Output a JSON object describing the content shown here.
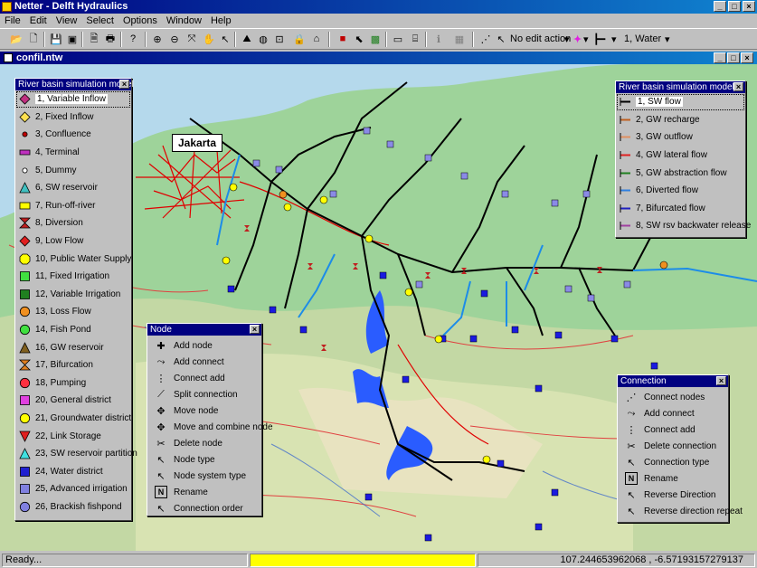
{
  "window": {
    "title": "Netter - Delft Hydraulics",
    "min": "_",
    "max": "□",
    "close": "×"
  },
  "menu": [
    "File",
    "Edit",
    "View",
    "Select",
    "Options",
    "Window",
    "Help"
  ],
  "toolbar": {
    "edit_action": "No edit action",
    "layer": "1, Water"
  },
  "document": {
    "title": "confil.ntw",
    "min": "_",
    "max": "□",
    "close": "×"
  },
  "map": {
    "city_label": "Jakarta"
  },
  "node_types_panel": {
    "title": "River basin simulation model",
    "close": "×",
    "items": [
      {
        "label": "1, Variable Inflow",
        "color": "#c03080",
        "shape": "diamond"
      },
      {
        "label": "2, Fixed Inflow",
        "color": "#ffe050",
        "shape": "diamond"
      },
      {
        "label": "3, Confluence",
        "color": "#c00000",
        "shape": "dot"
      },
      {
        "label": "4, Terminal",
        "color": "#c030c0",
        "shape": "bar"
      },
      {
        "label": "5, Dummy",
        "color": "#ffffff",
        "shape": "dot"
      },
      {
        "label": "6, SW reservoir",
        "color": "#40c0c0",
        "shape": "triangle"
      },
      {
        "label": "7, Run-off-river",
        "color": "#ffff00",
        "shape": "rect"
      },
      {
        "label": "8, Diversion",
        "color": "#c02020",
        "shape": "hourglass"
      },
      {
        "label": "9, Low Flow",
        "color": "#e02020",
        "shape": "diamond"
      },
      {
        "label": "10, Public Water Supply",
        "color": "#ffff00",
        "shape": "octagon"
      },
      {
        "label": "11, Fixed Irrigation",
        "color": "#40e040",
        "shape": "square"
      },
      {
        "label": "12, Variable Irrigation",
        "color": "#208020",
        "shape": "square"
      },
      {
        "label": "13, Loss Flow",
        "color": "#f09020",
        "shape": "circle"
      },
      {
        "label": "14, Fish Pond",
        "color": "#40e040",
        "shape": "circle"
      },
      {
        "label": "16, GW reservoir",
        "color": "#806020",
        "shape": "triangle"
      },
      {
        "label": "17, Bifurcation",
        "color": "#e08020",
        "shape": "hourglass"
      },
      {
        "label": "18, Pumping",
        "color": "#ff3040",
        "shape": "circle"
      },
      {
        "label": "20, General district",
        "color": "#e040e0",
        "shape": "square"
      },
      {
        "label": "21, Groundwater district",
        "color": "#ffff00",
        "shape": "circle"
      },
      {
        "label": "22, Link Storage",
        "color": "#e02020",
        "shape": "invtriangle"
      },
      {
        "label": "23, SW reservoir partition",
        "color": "#40e0e0",
        "shape": "triangle"
      },
      {
        "label": "24, Water district",
        "color": "#2020d0",
        "shape": "square"
      },
      {
        "label": "25, Advanced irrigation",
        "color": "#8080e0",
        "shape": "square"
      },
      {
        "label": "26, Brackish fishpond",
        "color": "#8080e0",
        "shape": "circle"
      }
    ]
  },
  "link_types_panel": {
    "title": "River basin simulation model",
    "close": "×",
    "items": [
      {
        "label": "1, SW flow",
        "color": "#000000"
      },
      {
        "label": "2, GW recharge",
        "color": "#c06020"
      },
      {
        "label": "3, GW outflow",
        "color": "#e09060"
      },
      {
        "label": "4, GW lateral flow",
        "color": "#e02020"
      },
      {
        "label": "5, GW abstraction flow",
        "color": "#208020"
      },
      {
        "label": "6, Diverted flow",
        "color": "#3080e0"
      },
      {
        "label": "7, Bifurcated flow",
        "color": "#2020c0"
      },
      {
        "label": "8, SW rsv backwater release",
        "color": "#a040a0"
      }
    ]
  },
  "node_panel": {
    "title": "Node",
    "close": "×",
    "items": [
      {
        "label": "Add node",
        "icon": "add-node-icon"
      },
      {
        "label": "Add connect",
        "icon": "add-connect-icon"
      },
      {
        "label": "Connect add",
        "icon": "connect-add-icon"
      },
      {
        "label": "Split connection",
        "icon": "split-connection-icon"
      },
      {
        "label": "Move node",
        "icon": "move-node-icon"
      },
      {
        "label": "Move and combine node",
        "icon": "move-combine-icon"
      },
      {
        "label": "Delete node",
        "icon": "delete-node-icon"
      },
      {
        "label": "Node type",
        "icon": "node-type-icon"
      },
      {
        "label": "Node system type",
        "icon": "node-system-type-icon"
      },
      {
        "label": "Rename",
        "icon": "rename-icon"
      },
      {
        "label": "Connection order",
        "icon": "connection-order-icon"
      }
    ]
  },
  "connection_panel": {
    "title": "Connection",
    "close": "×",
    "items": [
      {
        "label": "Connect nodes",
        "icon": "connect-nodes-icon"
      },
      {
        "label": "Add connect",
        "icon": "add-connect-icon"
      },
      {
        "label": "Connect add",
        "icon": "connect-add-icon"
      },
      {
        "label": "Delete connection",
        "icon": "delete-connection-icon"
      },
      {
        "label": "Connection type",
        "icon": "connection-type-icon"
      },
      {
        "label": "Rename",
        "icon": "rename-icon"
      },
      {
        "label": "Reverse Direction",
        "icon": "reverse-direction-icon"
      },
      {
        "label": "Reverse direction repeat",
        "icon": "reverse-repeat-icon"
      }
    ]
  },
  "status": {
    "ready": "Ready...",
    "coords": "107.244653962068 , -6.57193157279137"
  }
}
